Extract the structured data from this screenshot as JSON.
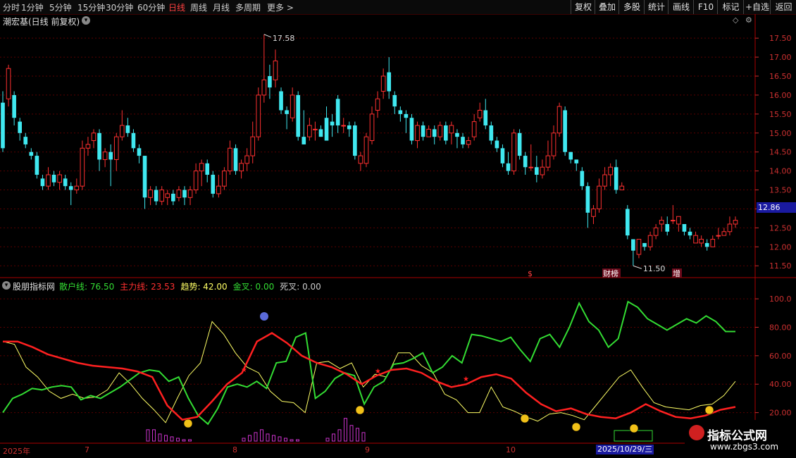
{
  "toolbar": {
    "periods": [
      "分时",
      "1分钟",
      "5分钟",
      "15分钟",
      "30分钟",
      "60分钟",
      "日线",
      "周线",
      "月线",
      "多周期",
      "更多 >"
    ],
    "active_period": "日线",
    "tools": [
      "复权",
      "叠加",
      "多股",
      "统计",
      "画线",
      "F10",
      "标记",
      "+自选",
      "返回"
    ]
  },
  "main": {
    "title": "潮宏基(日线 前复权)",
    "high_label": "17.58",
    "low_label": "11.50",
    "current_price": "12.86",
    "event_markers": [
      "$",
      "财榜",
      "增"
    ],
    "y_ticks": [
      "17.50",
      "17.00",
      "16.50",
      "16.00",
      "15.50",
      "15.00",
      "14.50",
      "14.00",
      "13.50",
      "13.00",
      "12.50",
      "12.00",
      "11.50"
    ]
  },
  "indicator": {
    "name": "股朋指标网",
    "items": [
      {
        "label": "散户线:",
        "value": "76.50",
        "color": "#33dd33"
      },
      {
        "label": "主力线:",
        "value": "23.53",
        "color": "#ff3030"
      },
      {
        "label": "趋势:",
        "value": "42.00",
        "color": "#ffff66"
      },
      {
        "label": "金叉:",
        "value": "0.00",
        "color": "#33dd33"
      },
      {
        "label": "死叉:",
        "value": "0.00",
        "color": "#cccccc"
      }
    ],
    "y_ticks": [
      "100.0",
      "80.00",
      "60.00",
      "40.00",
      "20.00"
    ]
  },
  "date_axis": {
    "labels": [
      "2025年",
      "7",
      "8",
      "9",
      "10"
    ],
    "cursor_date": "2025/10/29/三"
  },
  "watermark": {
    "title": "指标公式网",
    "url": "www.zbgs3.com"
  },
  "colors": {
    "up": "#ff3030",
    "down": "#40e8f0",
    "retail": "#33dd33",
    "main": "#ff2020",
    "trend": "#ffff66",
    "bar": "#cc33cc"
  },
  "chart_data": {
    "type": "candlestick",
    "ylim": [
      11.3,
      17.8
    ],
    "candles": [
      [
        15.8,
        14.6,
        16.1,
        14.5
      ],
      [
        15.9,
        16.7,
        16.8,
        15.7
      ],
      [
        16.0,
        15.4,
        16.1,
        15.2
      ],
      [
        15.3,
        15.0,
        15.4,
        14.8
      ],
      [
        14.9,
        14.7,
        15.0,
        14.6
      ],
      [
        14.5,
        14.4,
        14.6,
        14.3
      ],
      [
        14.4,
        13.9,
        14.5,
        13.8
      ],
      [
        13.8,
        13.6,
        13.9,
        13.5
      ],
      [
        13.6,
        13.9,
        14.1,
        13.5
      ],
      [
        13.9,
        13.7,
        14.0,
        13.6
      ],
      [
        13.7,
        13.9,
        14.0,
        13.5
      ],
      [
        13.8,
        13.6,
        13.9,
        13.5
      ],
      [
        13.6,
        13.5,
        13.7,
        13.1
      ],
      [
        13.5,
        13.6,
        13.8,
        13.4
      ],
      [
        13.6,
        14.6,
        14.8,
        13.5
      ],
      [
        14.6,
        14.7,
        14.9,
        14.4
      ],
      [
        14.8,
        15.0,
        15.1,
        14.6
      ],
      [
        15.0,
        14.3,
        15.1,
        14.0
      ],
      [
        14.3,
        14.5,
        14.6,
        14.1
      ],
      [
        14.5,
        14.3,
        14.7,
        13.6
      ],
      [
        14.3,
        14.9,
        15.0,
        14.0
      ],
      [
        14.9,
        15.2,
        15.6,
        14.8
      ],
      [
        15.2,
        15.0,
        15.4,
        14.9
      ],
      [
        15.0,
        14.6,
        15.1,
        14.5
      ],
      [
        14.6,
        14.4,
        14.7,
        14.2
      ],
      [
        14.4,
        13.3,
        14.4,
        13.0
      ],
      [
        13.3,
        13.5,
        13.6,
        13.1
      ],
      [
        13.5,
        13.2,
        13.6,
        13.1
      ],
      [
        13.2,
        13.5,
        13.6,
        13.1
      ],
      [
        13.3,
        13.4,
        13.5,
        13.1
      ],
      [
        13.4,
        13.2,
        13.5,
        13.1
      ],
      [
        13.3,
        13.5,
        13.6,
        13.2
      ],
      [
        13.5,
        13.3,
        13.6,
        13.1
      ],
      [
        13.3,
        13.5,
        13.6,
        13.1
      ],
      [
        13.5,
        14.0,
        14.2,
        13.4
      ],
      [
        14.0,
        14.2,
        14.3,
        13.6
      ],
      [
        14.2,
        13.9,
        14.3,
        13.7
      ],
      [
        13.9,
        13.4,
        14.0,
        13.3
      ],
      [
        13.4,
        13.6,
        13.9,
        13.3
      ],
      [
        13.6,
        14.0,
        14.1,
        13.5
      ],
      [
        14.0,
        14.6,
        14.8,
        13.9
      ],
      [
        14.6,
        14.0,
        14.7,
        13.9
      ],
      [
        14.0,
        14.2,
        14.3,
        13.8
      ],
      [
        14.2,
        14.4,
        14.6,
        14.0
      ],
      [
        14.4,
        14.9,
        15.3,
        14.2
      ],
      [
        14.9,
        16.0,
        16.2,
        14.8
      ],
      [
        16.0,
        16.4,
        17.6,
        15.8
      ],
      [
        16.5,
        16.2,
        16.8,
        15.9
      ],
      [
        16.4,
        16.9,
        17.2,
        16.2
      ],
      [
        16.1,
        15.6,
        16.2,
        15.5
      ],
      [
        15.6,
        15.5,
        15.7,
        15.1
      ],
      [
        15.4,
        16.0,
        16.2,
        15.3
      ],
      [
        16.0,
        14.9,
        16.1,
        14.8
      ],
      [
        14.9,
        14.7,
        15.6,
        14.7
      ],
      [
        14.9,
        15.2,
        15.4,
        14.8
      ],
      [
        15.1,
        15.1,
        15.3,
        14.8
      ],
      [
        15.1,
        14.9,
        15.2,
        14.9
      ],
      [
        15.4,
        14.8,
        15.7,
        14.8
      ],
      [
        15.3,
        15.2,
        15.5,
        14.9
      ],
      [
        15.9,
        15.2,
        16.0,
        15.0
      ],
      [
        15.2,
        15.2,
        15.4,
        15.0
      ],
      [
        15.2,
        15.1,
        15.3,
        14.9
      ],
      [
        15.2,
        14.4,
        15.3,
        14.3
      ],
      [
        14.2,
        14.4,
        14.5,
        14.0
      ],
      [
        14.2,
        14.9,
        15.0,
        14.1
      ],
      [
        14.8,
        15.5,
        15.7,
        14.7
      ],
      [
        15.6,
        15.9,
        16.1,
        15.4
      ],
      [
        16.1,
        16.5,
        16.7,
        15.9
      ],
      [
        16.6,
        16.1,
        17.0,
        15.9
      ],
      [
        16.0,
        15.7,
        16.1,
        15.5
      ],
      [
        15.6,
        15.5,
        15.7,
        15.3
      ],
      [
        15.5,
        15.4,
        15.6,
        15.0
      ],
      [
        15.4,
        14.8,
        15.5,
        14.7
      ],
      [
        14.8,
        15.2,
        15.3,
        14.6
      ],
      [
        15.2,
        14.9,
        15.3,
        14.8
      ],
      [
        14.9,
        15.1,
        15.2,
        14.9
      ],
      [
        15.1,
        14.9,
        15.2,
        14.7
      ],
      [
        14.9,
        15.2,
        15.3,
        14.8
      ],
      [
        15.2,
        14.8,
        15.3,
        14.7
      ],
      [
        15.0,
        15.2,
        15.3,
        14.7
      ],
      [
        15.0,
        14.9,
        15.1,
        14.6
      ],
      [
        14.9,
        14.7,
        15.0,
        14.6
      ],
      [
        14.7,
        14.8,
        14.9,
        14.6
      ],
      [
        14.9,
        15.3,
        15.5,
        14.8
      ],
      [
        15.4,
        15.6,
        15.8,
        15.3
      ],
      [
        15.6,
        15.2,
        15.9,
        15.1
      ],
      [
        15.2,
        14.8,
        15.3,
        14.7
      ],
      [
        14.8,
        14.6,
        14.9,
        14.5
      ],
      [
        14.6,
        14.2,
        14.7,
        14.1
      ],
      [
        14.2,
        14.0,
        14.5,
        13.9
      ],
      [
        14.0,
        15.0,
        15.1,
        13.9
      ],
      [
        15.0,
        14.4,
        15.1,
        14.3
      ],
      [
        14.4,
        14.1,
        14.5,
        13.9
      ],
      [
        14.1,
        14.1,
        14.7,
        14.0
      ],
      [
        14.1,
        13.9,
        14.4,
        13.7
      ],
      [
        13.9,
        14.1,
        14.3,
        13.8
      ],
      [
        14.1,
        14.4,
        14.8,
        14.0
      ],
      [
        14.4,
        15.0,
        15.2,
        14.3
      ],
      [
        15.0,
        15.7,
        15.8,
        14.9
      ],
      [
        15.6,
        14.5,
        15.7,
        14.4
      ],
      [
        14.5,
        14.3,
        14.5,
        14.2
      ],
      [
        14.3,
        14.2,
        14.3,
        14.0
      ],
      [
        14.0,
        13.6,
        14.1,
        13.5
      ],
      [
        13.6,
        12.9,
        13.7,
        12.5
      ],
      [
        12.8,
        13.0,
        13.1,
        12.6
      ],
      [
        13.0,
        13.6,
        13.8,
        12.9
      ],
      [
        13.6,
        13.9,
        14.1,
        13.5
      ],
      [
        13.9,
        14.1,
        14.2,
        13.6
      ],
      [
        14.1,
        13.5,
        14.3,
        13.4
      ],
      [
        13.5,
        13.6,
        13.7,
        13.5
      ],
      [
        13.0,
        12.3,
        13.1,
        12.2
      ],
      [
        12.2,
        11.9,
        12.1,
        11.5
      ],
      [
        11.8,
        12.2,
        12.2,
        11.7
      ],
      [
        12.1,
        12.0,
        12.1,
        11.9
      ],
      [
        12.0,
        12.3,
        12.4,
        11.9
      ],
      [
        12.3,
        12.5,
        12.6,
        12.2
      ],
      [
        12.6,
        12.7,
        12.8,
        12.4
      ],
      [
        12.6,
        12.4,
        12.8,
        12.3
      ],
      [
        12.7,
        12.7,
        13.1,
        12.6
      ],
      [
        12.6,
        12.8,
        12.8,
        12.4
      ],
      [
        12.6,
        12.4,
        12.6,
        12.3
      ],
      [
        12.4,
        12.3,
        12.5,
        12.2
      ],
      [
        12.1,
        12.3,
        12.4,
        12.1
      ],
      [
        12.1,
        12.2,
        12.3,
        12.0
      ],
      [
        12.1,
        12.0,
        12.2,
        11.9
      ],
      [
        12.0,
        12.2,
        12.3,
        12.0
      ],
      [
        12.3,
        12.3,
        12.5,
        12.2
      ],
      [
        12.3,
        12.4,
        12.5,
        12.3
      ],
      [
        12.4,
        12.6,
        12.8,
        12.3
      ],
      [
        12.6,
        12.7,
        12.8,
        12.5
      ]
    ]
  },
  "indicator_data": {
    "type": "line",
    "ylim": [
      0,
      105
    ],
    "retail": [
      20,
      30,
      33,
      37,
      36,
      38,
      39,
      38,
      29,
      32,
      30,
      34,
      38,
      43,
      48,
      50,
      49,
      42,
      45,
      30,
      18,
      12,
      23,
      38,
      40,
      38,
      42,
      37,
      55,
      56,
      73,
      76,
      30,
      35,
      44,
      48,
      46,
      26,
      38,
      42,
      54,
      55,
      58,
      62,
      48,
      52,
      60,
      55,
      75,
      74,
      72,
      70,
      73,
      64,
      56,
      72,
      75,
      66,
      80,
      97,
      84,
      78,
      66,
      72,
      98,
      94,
      86,
      82,
      78,
      82,
      86,
      83,
      88,
      84,
      77,
      77
    ],
    "main": [
      70,
      70,
      66,
      61,
      58,
      55,
      53,
      52,
      51,
      49,
      45,
      25,
      15,
      17,
      28,
      40,
      48,
      70,
      76,
      69,
      60,
      55,
      52,
      47,
      40,
      46,
      50,
      51,
      48,
      42,
      38,
      40,
      45,
      47,
      44,
      34,
      26,
      21,
      23,
      19,
      17,
      16,
      20,
      26,
      21,
      17,
      16,
      18,
      22,
      24
    ],
    "trend": [
      70,
      68,
      52,
      45,
      35,
      30,
      33,
      30,
      31,
      36,
      48,
      40,
      30,
      22,
      13,
      30,
      46,
      55,
      84,
      75,
      62,
      52,
      48,
      35,
      28,
      27,
      20,
      55,
      56,
      51,
      55,
      38,
      47,
      45,
      62,
      62,
      53,
      48,
      33,
      29,
      20,
      20,
      38,
      24,
      21,
      17,
      14,
      19,
      20,
      18,
      15,
      25,
      35,
      45,
      50,
      38,
      27,
      24,
      23,
      22,
      25,
      26,
      32,
      42
    ],
    "bars": [
      8,
      8,
      5,
      4,
      3,
      2,
      1,
      1,
      0,
      0,
      0,
      0,
      0,
      0,
      0,
      0,
      2,
      4,
      6,
      8,
      5,
      4,
      3,
      2,
      1,
      1,
      0,
      0,
      0,
      0,
      2,
      5,
      8,
      16,
      11,
      9,
      6
    ]
  }
}
